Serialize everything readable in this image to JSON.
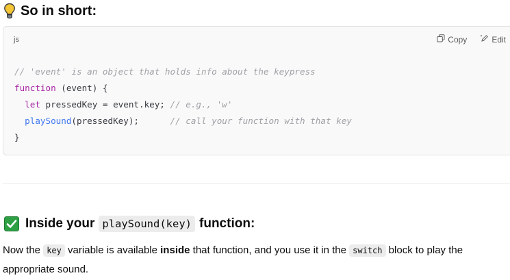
{
  "section1": {
    "icon": "lightbulb-icon",
    "title": "So in short:"
  },
  "code_block": {
    "language": "js",
    "copy_label": "Copy",
    "edit_label": "Edit",
    "lines": {
      "l1_comment": "// 'event' is an object that holds info about the keypress",
      "l2_keyword": "function",
      "l2_rest": " (event) {",
      "l3_indent": "  ",
      "l3_keyword": "let",
      "l3_rest": " pressedKey = event.key; ",
      "l3_comment": "// e.g., 'w'",
      "l4_indent": "  ",
      "l4_fn": "playSound",
      "l4_rest": "(pressedKey);      ",
      "l4_comment": "// call your function with that key",
      "l5": "}"
    }
  },
  "section2": {
    "icon": "check-mark-icon",
    "title_prefix": "Inside your",
    "title_code": "playSound(key)",
    "title_suffix": "function:",
    "para": {
      "p1": "Now the ",
      "code1": "key",
      "p2": " variable is available ",
      "bold": "inside",
      "p3": " that function, and you use it in the ",
      "code2": "switch",
      "p4": " block to play the appropriate sound."
    }
  },
  "colors": {
    "keyword": "#a626a4",
    "function": "#4078f2",
    "comment": "#a0a1a7",
    "check_green": "#2ea043"
  }
}
